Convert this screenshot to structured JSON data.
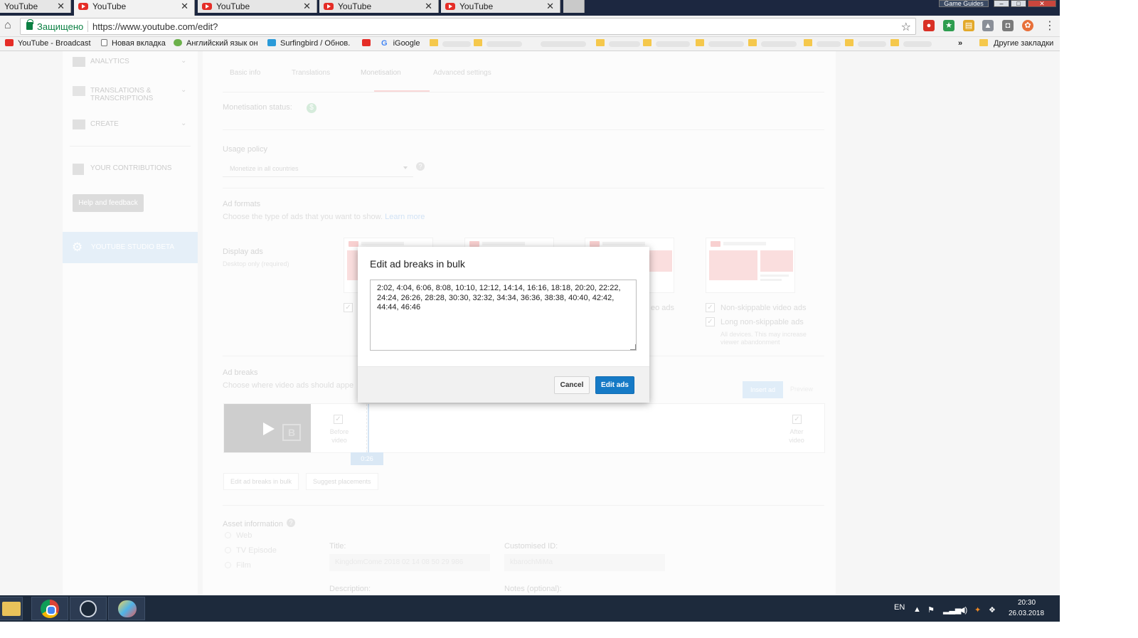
{
  "browser": {
    "tabs": [
      {
        "title": "YouTube",
        "active": false
      },
      {
        "title": "YouTube",
        "active": true
      },
      {
        "title": "YouTube",
        "active": false
      },
      {
        "title": "YouTube",
        "active": false
      },
      {
        "title": "YouTube",
        "active": false
      }
    ],
    "game_guides": "Game Guides",
    "secure_label": "Защищено",
    "url": "https://www.youtube.com/edit?",
    "bookmarks": [
      "YouTube - Broadcast",
      "Новая вкладка",
      "Английский язык он",
      "Surfingbird / Обнов.",
      "iGoogle"
    ],
    "bookmarks_more": "»",
    "other_bookmarks": "Другие закладки"
  },
  "sidebar": {
    "items": [
      {
        "label": "ANALYTICS",
        "icon": "bar-chart-icon"
      },
      {
        "label": "TRANSLATIONS & TRANSCRIPTIONS",
        "icon": "translate-icon"
      },
      {
        "label": "CREATE",
        "icon": "video-camera-icon"
      },
      {
        "label": "YOUR CONTRIBUTIONS",
        "icon": "contributions-icon"
      }
    ],
    "help_button": "Help and feedback",
    "studio_beta": "YOUTUBE STUDIO BETA"
  },
  "page": {
    "tabs": [
      "Basic info",
      "Translations",
      "Monetisation",
      "Advanced settings"
    ],
    "active_tab": "Monetisation",
    "monetisation_status_label": "Monetisation status:",
    "monetisation_status_icon": "$",
    "usage_policy_title": "Usage policy",
    "usage_policy_value": "Monetize in all countries",
    "help_icon": "?",
    "ad_formats_title": "Ad formats",
    "ad_formats_sub": "Choose the type of ads that you want to show.",
    "learn_more": "Learn more",
    "display_ads_label": "Display ads",
    "display_ads_sub": "Desktop only (required)",
    "video_ads_partial": "eo ads",
    "non_skippable": "Non-skippable video ads",
    "long_non_skippable": "Long non-skippable ads",
    "all_devices_note": "All devices. This may increase viewer abandonment",
    "ad_breaks_title": "Ad breaks",
    "ad_breaks_sub": "Choose where video ads should appe",
    "insert_ad": "Insert ad",
    "preview": "Preview",
    "before_video": "Before video",
    "after_video": "After video",
    "time_marker": "0:26",
    "edit_bulk_button": "Edit ad breaks in bulk",
    "suggest_button": "Suggest placements",
    "asset_info_title": "Asset information",
    "asset_types": [
      "Web",
      "TV Episode",
      "Film"
    ],
    "title_label": "Title:",
    "title_value": "KingdomCome 2018 02 14 08 50 29 986",
    "custom_id_label": "Customised ID:",
    "custom_id_value": "kbarochMiMa",
    "description_label": "Description:",
    "notes_label": "Notes (optional):"
  },
  "modal": {
    "title": "Edit ad breaks in bulk",
    "value": "2:02, 4:04, 6:06, 8:08, 10:10, 12:12, 14:14, 16:16, 18:18, 20:20, 22:22, 24:24, 26:26, 28:28, 30:30, 32:32, 34:34, 36:36, 38:38, 40:40, 42:42, 44:44, 46:46",
    "cancel_label": "Cancel",
    "confirm_label": "Edit ads"
  },
  "taskbar": {
    "language": "EN",
    "time": "20:30",
    "date": "26.03.2018"
  }
}
